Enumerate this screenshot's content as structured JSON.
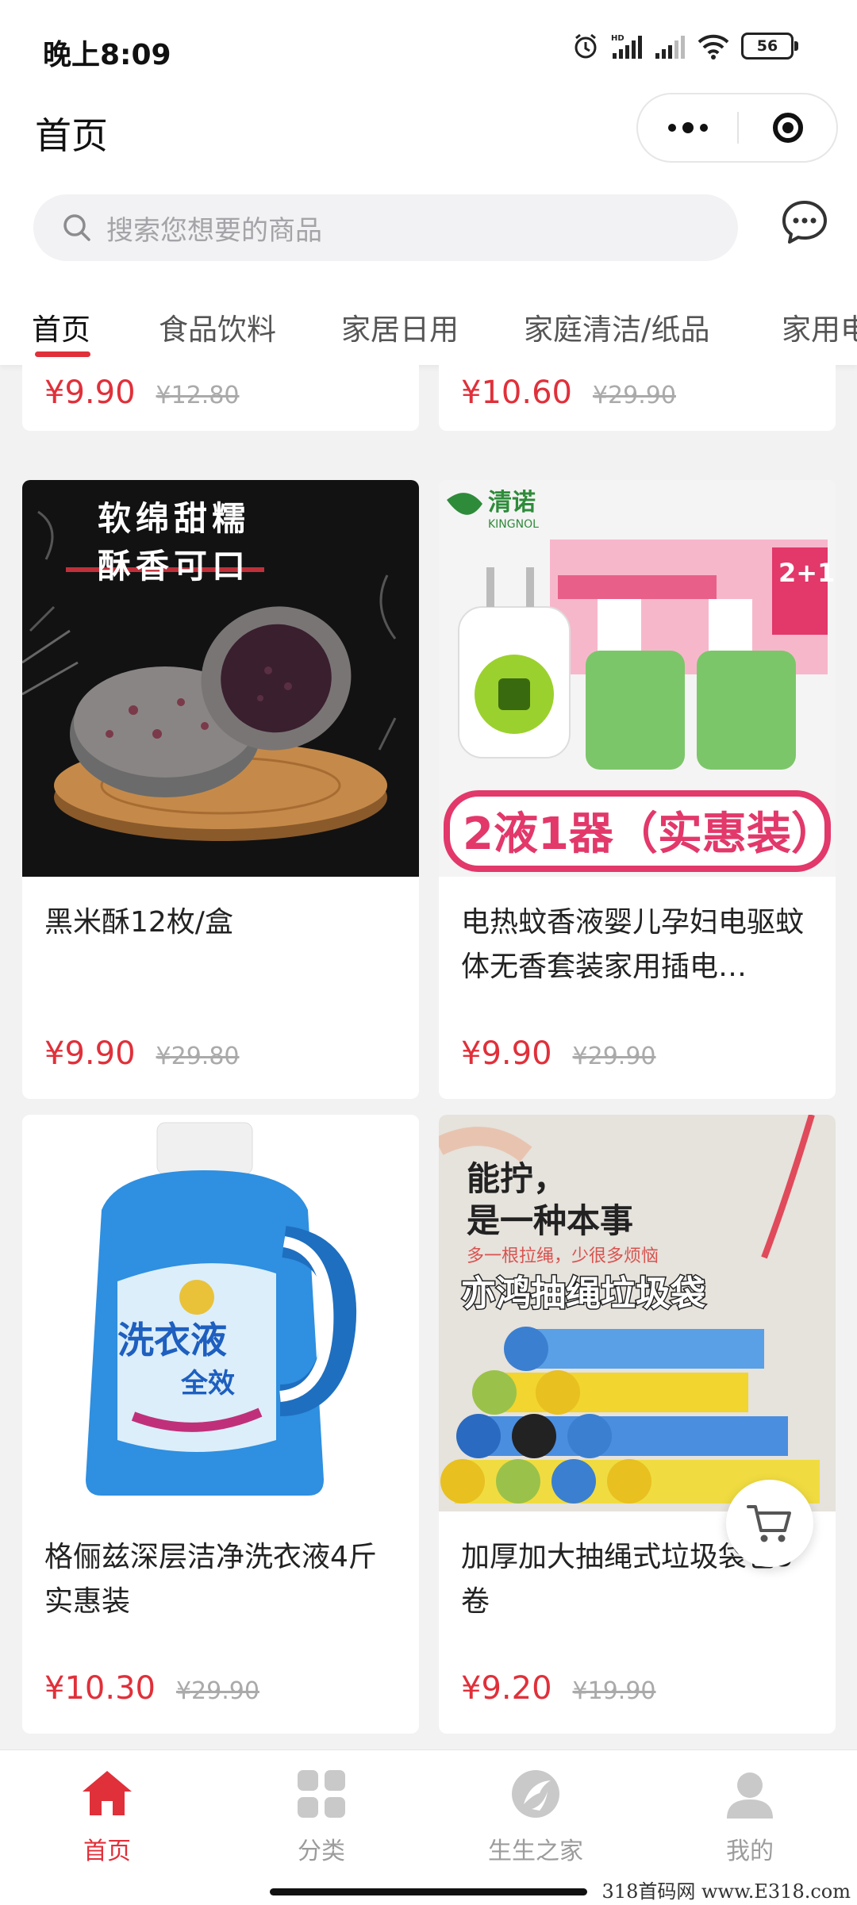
{
  "status_bar": {
    "time": "晚上8:09",
    "battery": "56"
  },
  "nav": {
    "title": "首页"
  },
  "search": {
    "placeholder": "搜索您想要的商品"
  },
  "tabs": [
    "首页",
    "食品饮料",
    "家居日用",
    "家庭清洁/纸品",
    "家用电"
  ],
  "partial_row": [
    {
      "price": "¥9.90",
      "original_price": "¥12.80"
    },
    {
      "price": "¥10.60",
      "original_price": "¥29.90"
    }
  ],
  "products": [
    {
      "name": "黑米酥12枚/盒",
      "price": "¥9.90",
      "original_price": "¥29.80",
      "image_text": [
        "软绵甜糯",
        "酥香可口"
      ]
    },
    {
      "name": "电热蚊香液婴儿孕妇电驱蚊体无香套装家用插电…",
      "price": "¥9.90",
      "original_price": "¥29.90",
      "image_text": [
        "清诺",
        "KINGNOL",
        "2液1器（实惠装）",
        "2+1"
      ]
    },
    {
      "name": "格俪兹深层洁净洗衣液4斤实惠装",
      "price": "¥10.30",
      "original_price": "¥29.90",
      "image_text": [
        "洗衣液",
        "全效"
      ]
    },
    {
      "name": "加厚加大抽绳式垃圾袋包5卷",
      "price": "¥9.20",
      "original_price": "¥19.90",
      "image_text": [
        "能拧，",
        "是一种本事",
        "多一根拉绳，少很多烦恼",
        "亦鸿抽绳垃圾袋"
      ]
    }
  ],
  "tab_bar": [
    {
      "label": "首页",
      "icon": "home-icon",
      "active": true
    },
    {
      "label": "分类",
      "icon": "category-grid-icon"
    },
    {
      "label": "生生之家",
      "icon": "shengsheng-logo-icon"
    },
    {
      "label": "我的",
      "icon": "profile-icon"
    }
  ],
  "watermark": "318首码网 www.E318.com",
  "colors": {
    "accent": "#e0303a",
    "background": "#f2f2f2"
  }
}
